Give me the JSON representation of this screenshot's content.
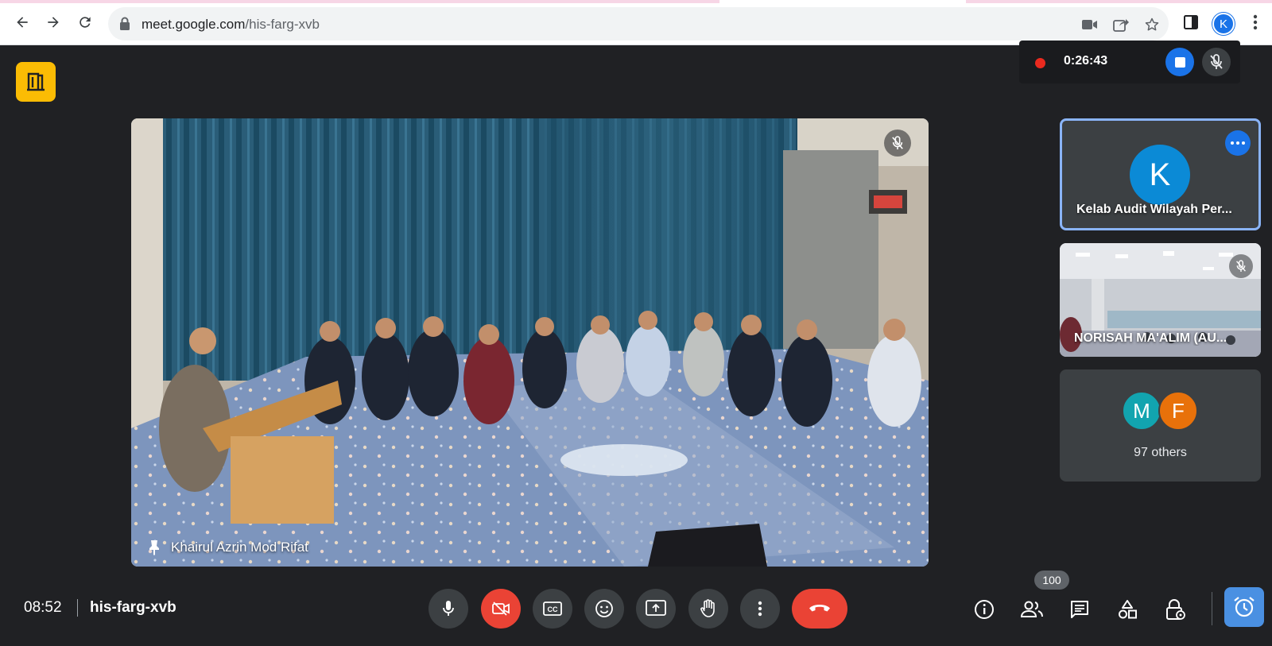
{
  "browser": {
    "url_host": "meet.google.com",
    "url_path": "/his-farg-xvb",
    "profile_initial": "K"
  },
  "recording": {
    "elapsed": "0:26:43"
  },
  "main_tile": {
    "participant_name": "Khairul Azrin Mod Rifat"
  },
  "side_tiles": [
    {
      "initial": "K",
      "name": "Kelab Audit Wilayah Per..."
    },
    {
      "name": "NORISAH MA'ALIM (AU..."
    },
    {
      "avatars": [
        "M",
        "F"
      ],
      "label": "97 others"
    }
  ],
  "bottom_bar": {
    "time": "08:52",
    "meeting_code": "his-farg-xvb",
    "participant_count": "100"
  },
  "colors": {
    "accent_blue": "#1a73e8",
    "end_call_red": "#ea4335",
    "logo_yellow": "#fbbc04",
    "avatar_m": "#12a4af",
    "avatar_f": "#e8710a"
  },
  "icons": [
    "back-icon",
    "forward-icon",
    "reload-icon",
    "lock-icon",
    "camera-icon",
    "share-icon",
    "star-icon",
    "sidepanel-icon",
    "kebab-icon",
    "door-icon",
    "mic-icon",
    "camera-off-icon",
    "captions-icon",
    "emoji-icon",
    "present-icon",
    "hand-icon",
    "more-vert-icon",
    "end-call-icon",
    "info-icon",
    "people-icon",
    "chat-icon",
    "activities-icon",
    "host-controls-icon",
    "alarm-icon",
    "pin-icon",
    "mic-off-icon"
  ]
}
